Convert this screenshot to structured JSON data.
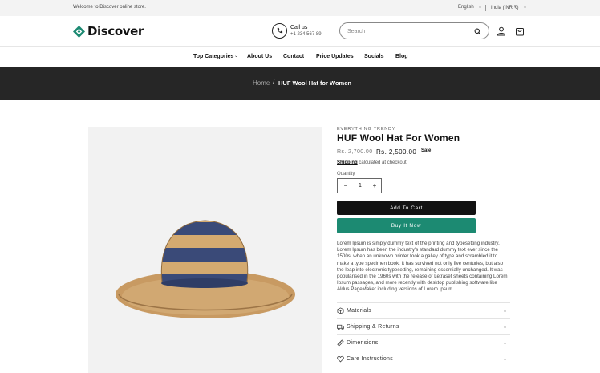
{
  "announcement": {
    "welcome_text": "Welcome to Discover online store.",
    "language": "English",
    "country": "India (INR ₹)"
  },
  "header": {
    "logo_text": "Discover",
    "call_label": "Call us",
    "call_number": "+1 234 567 89",
    "search_placeholder": "Search"
  },
  "nav": {
    "items": [
      {
        "label": "Top Categories",
        "has_dropdown": true
      },
      {
        "label": "About Us"
      },
      {
        "label": "Contact"
      },
      {
        "label": "Price Updates"
      },
      {
        "label": "Socials"
      },
      {
        "label": "Blog"
      }
    ]
  },
  "breadcrumb": {
    "home": "Home",
    "separator": "/",
    "current": "HUF Wool Hat for Women"
  },
  "product": {
    "vendor": "EVERYTHING TRENDY",
    "title": "HUF Wool Hat For Women",
    "regular_price": "Rs. 2,700.00",
    "sale_price": "Rs. 2,500.00",
    "sale_badge": "Sale",
    "shipping_link": "Shipping",
    "shipping_text": "calculated at checkout.",
    "quantity_label": "Quantity",
    "quantity_value": "1",
    "add_to_cart": "Add To Cart",
    "buy_now": "Buy It Now",
    "description": "Lorem Ipsum is simply dummy text of the printing and typesetting industry. Lorem Ipsum has been the industry's standard dummy text ever since the 1500s, when an unknown printer took a galley of type and scrambled it to make a type specimen book. It has survived not only five centuries, but also the leap into electronic typesetting, remaining essentially unchanged. It was popularised in the 1960s with the release of Letraset sheets containing Lorem Ipsum passages, and more recently with desktop publishing software like Aldus PageMaker including versions of Lorem Ipsum."
  },
  "accordions": [
    {
      "label": "Materials",
      "icon": "materials-icon"
    },
    {
      "label": "Shipping & Returns",
      "icon": "truck-icon"
    },
    {
      "label": "Dimensions",
      "icon": "ruler-icon"
    },
    {
      "label": "Care Instructions",
      "icon": "heart-icon"
    }
  ],
  "colors": {
    "accent_green": "#1c8a72",
    "banner_dark": "#262626",
    "button_dark": "#121212"
  }
}
